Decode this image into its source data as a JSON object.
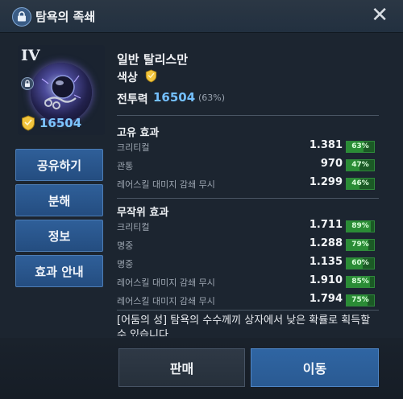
{
  "window": {
    "title": "탐욕의 족쇄",
    "close_glyph": "✕"
  },
  "portrait": {
    "tier": "IV",
    "power": "16504"
  },
  "side_buttons": [
    {
      "label": "공유하기"
    },
    {
      "label": "분해"
    },
    {
      "label": "정보"
    },
    {
      "label": "효과 안내"
    }
  ],
  "item": {
    "name": "일반 탈리스만",
    "color_label": "색상",
    "combat_power_label": "전투력",
    "combat_power_value": "16504",
    "combat_power_pct": "(63%)"
  },
  "unique_effects": {
    "title": "고유 효과",
    "stats": [
      {
        "name": "크리티컬",
        "value": "1.381",
        "pct": "63%",
        "fraction": 0.63
      },
      {
        "name": "관통",
        "value": "970",
        "pct": "47%",
        "fraction": 0.47
      },
      {
        "name": "레어스킬 대미지 감쇄 무시",
        "value": "1.299",
        "pct": "46%",
        "fraction": 0.46
      }
    ]
  },
  "random_effects": {
    "title": "무작위 효과",
    "stats": [
      {
        "name": "크리티컬",
        "value": "1.711",
        "pct": "89%",
        "fraction": 0.89
      },
      {
        "name": "명중",
        "value": "1.288",
        "pct": "79%",
        "fraction": 0.79
      },
      {
        "name": "명중",
        "value": "1.135",
        "pct": "60%",
        "fraction": 0.6
      },
      {
        "name": "레어스킬 대미지 감쇄 무시",
        "value": "1.910",
        "pct": "85%",
        "fraction": 0.85
      },
      {
        "name": "레어스킬 대미지 감쇄 무시",
        "value": "1.794",
        "pct": "75%",
        "fraction": 0.75
      }
    ]
  },
  "description": "[어둠의 성] 탐욕의 수수께끼 상자에서 낮은 확률로 획득할 수 있습니다.",
  "actions": {
    "sell": "판매",
    "move": "이동"
  },
  "colors": {
    "accent_blue": "#74c0ff",
    "gold": "#f2c53d",
    "pct_green": "#2a8c35",
    "button_blue": "#2f65a3"
  },
  "icons": {
    "title": "lock-icon",
    "grade": "shield-icon",
    "close": "close-icon"
  }
}
